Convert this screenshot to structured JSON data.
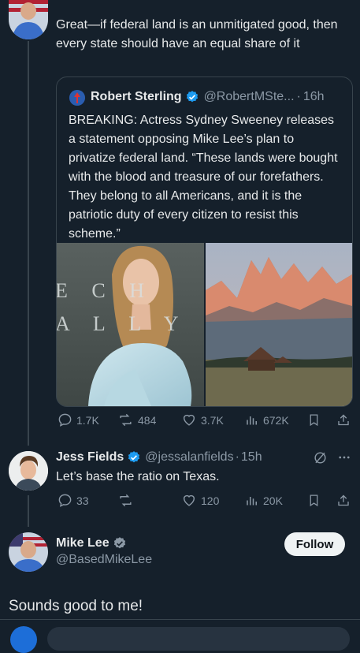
{
  "top_reply": {
    "text": "Great—if federal land is an unmitigated good, then every state should have an equal share of it"
  },
  "quoted_post": {
    "author_name": "Robert Sterling",
    "handle": "@RobertMSte...",
    "time": "16h",
    "text": "BREAKING: Actress Sydney Sweeney releases a statement opposing Mike Lee’s plan to privatize federal land. “These lands were bought with the blood and treasure of our forefathers. They belong to all Americans, and it is the patriotic duty of every citizen to resist this scheme.”",
    "photo_sign_text": "E C H\nA L L Y"
  },
  "post_actions": {
    "replies": "1.7K",
    "reposts": "484",
    "likes": "3.7K",
    "views": "672K"
  },
  "jess_reply": {
    "author_name": "Jess Fields",
    "handle": "@jessalanfields",
    "time": "15h",
    "text": "Let’s base the ratio on Texas.",
    "replies": "33",
    "likes": "120",
    "views": "20K"
  },
  "mike_post": {
    "author_name": "Mike Lee",
    "handle": "@BasedMikeLee",
    "follow_label": "Follow",
    "text": "Sounds good to me!"
  },
  "colors": {
    "background": "#15202b",
    "verified_blue": "#1d9bf0",
    "verified_gray": "#8b98a5",
    "muted_text": "#8b98a5"
  }
}
